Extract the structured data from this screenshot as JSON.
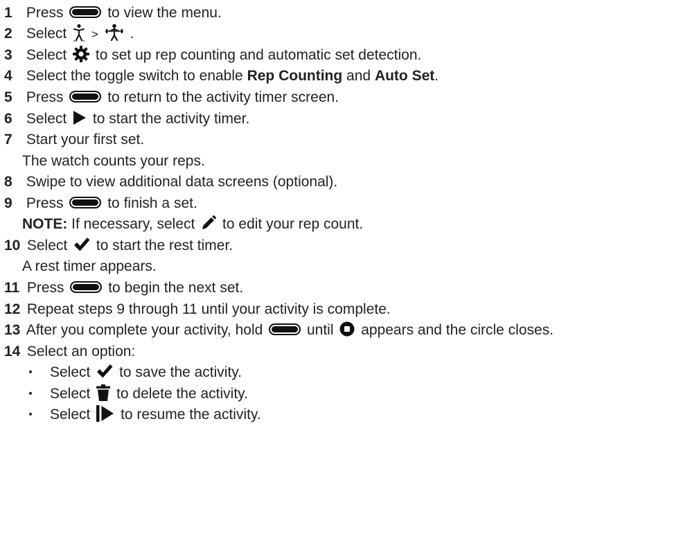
{
  "steps": [
    {
      "num": "1",
      "pre": "Press",
      "post": "to view the menu.",
      "icon": "action-button-icon"
    },
    {
      "num": "2",
      "pre": "Select",
      "mid": ">",
      "post": ".",
      "icons": [
        "strength-icon",
        "weightlifting-icon"
      ]
    },
    {
      "num": "3",
      "pre": "Select",
      "post": "to set up rep counting and automatic set detection.",
      "icon": "gear-icon"
    },
    {
      "num": "4",
      "pre": "Select the toggle switch to enable",
      "bold1": "Rep Counting",
      "and": "and",
      "bold2": "Auto Set",
      "end": "."
    },
    {
      "num": "5",
      "pre": "Press",
      "post": "to return to the activity timer screen.",
      "icon": "action-button-icon"
    },
    {
      "num": "6",
      "pre": "Select",
      "post": "to start the activity timer.",
      "icon": "play-icon"
    },
    {
      "num": "7",
      "text": "Start your first set.",
      "sub": "The watch counts your reps."
    },
    {
      "num": "8",
      "text": "Swipe to view additional data screens (optional)."
    },
    {
      "num": "9",
      "pre": "Press",
      "post": "to finish a set.",
      "icon": "action-button-icon",
      "note_label": "NOTE:",
      "note_pre": "If necessary, select",
      "note_post": "to edit your rep count."
    },
    {
      "num": "10",
      "pre": "Select",
      "post": "to start the rest timer.",
      "icon": "checkmark-icon",
      "sub": "A rest timer appears."
    },
    {
      "num": "11",
      "pre": "Press",
      "post": "to begin the next set.",
      "icon": "action-button-icon"
    },
    {
      "num": "12",
      "text": "Repeat steps 9 through 11 until your activity is complete."
    },
    {
      "num": "13",
      "pre": "After you complete your activity, hold",
      "mid": "until",
      "post": "appears and the circle closes.",
      "icons": [
        "action-button-icon",
        "stop-icon"
      ]
    },
    {
      "num": "14",
      "text": "Select an option:"
    }
  ],
  "options": [
    {
      "bullet": "•",
      "pre": "Select",
      "post": "to save the activity.",
      "icon": "checkmark-icon"
    },
    {
      "bullet": "•",
      "pre": "Select",
      "post": "to delete the activity.",
      "icon": "trash-icon"
    },
    {
      "bullet": "•",
      "pre": "Select",
      "post": "to resume the activity.",
      "icon": "resume-icon"
    }
  ],
  "colors": {
    "text": "#222222",
    "icon": "#111111"
  }
}
